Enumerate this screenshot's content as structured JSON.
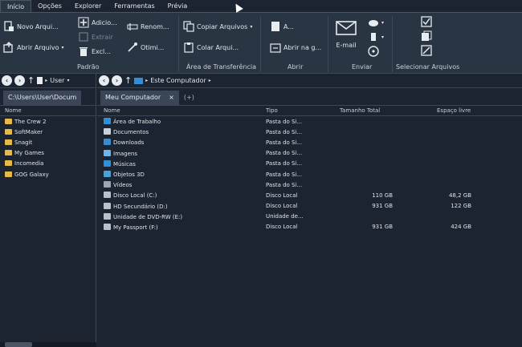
{
  "tabs": [
    "Início",
    "Opções",
    "Explorer",
    "Ferramentas",
    "Prévia"
  ],
  "ribbon": {
    "padrao": {
      "novo": "Novo Arqui...",
      "abrir": "Abrir Arquivo",
      "adicionar": "Adicio...",
      "extrair": "Extrair",
      "excluir": "Excl...",
      "renomear": "Renom...",
      "otimizar": "Otimi...",
      "label": "Padrão"
    },
    "transferencia": {
      "copiar": "Copiar Arquivos",
      "colar": "Colar Arqui...",
      "label": "Área de Transferência"
    },
    "abrir": {
      "a": "A...",
      "abrir_com": "Abrir na g...",
      "label": "Abrir"
    },
    "enviar": {
      "email": "E-mail",
      "label": "Enviar"
    },
    "selecionar": {
      "label": "Selecionar Arquivos"
    }
  },
  "left": {
    "addr": "User",
    "tab": "C:\\Users\\User\\Docum",
    "col_nome": "Nome",
    "items": [
      "The Crew 2",
      "SoftMaker",
      "Snagit",
      "My Games",
      "Incomedia",
      "GOG Galaxy"
    ]
  },
  "right": {
    "addr": "Este Computador",
    "tab": "Meu Computador",
    "tab_close": "×",
    "tab_add": "(+)",
    "cols": {
      "nome": "Nome",
      "tipo": "Tipo",
      "tamanho": "Tamanho Total",
      "espaco": "Espaço livre"
    },
    "rows": [
      {
        "nome": "Área de Trabalho",
        "tipo": "Pasta do Si...",
        "tamanho": "",
        "espaco": ""
      },
      {
        "nome": "Documentos",
        "tipo": "Pasta do Si...",
        "tamanho": "",
        "espaco": ""
      },
      {
        "nome": "Downloads",
        "tipo": "Pasta do Si...",
        "tamanho": "",
        "espaco": ""
      },
      {
        "nome": "Imagens",
        "tipo": "Pasta do Si...",
        "tamanho": "",
        "espaco": ""
      },
      {
        "nome": "Músicas",
        "tipo": "Pasta do Si...",
        "tamanho": "",
        "espaco": ""
      },
      {
        "nome": "Objetos 3D",
        "tipo": "Pasta do Si...",
        "tamanho": "",
        "espaco": ""
      },
      {
        "nome": "Vídeos",
        "tipo": "Pasta do Si...",
        "tamanho": "",
        "espaco": ""
      },
      {
        "nome": "Disco Local (C:)",
        "tipo": "Disco Local",
        "tamanho": "110 GB",
        "espaco": "48,2 GB"
      },
      {
        "nome": "HD Secundário (D:)",
        "tipo": "Disco Local",
        "tamanho": "931 GB",
        "espaco": "122 GB"
      },
      {
        "nome": "Unidade de DVD-RW (E:)",
        "tipo": "Unidade de...",
        "tamanho": "",
        "espaco": ""
      },
      {
        "nome": "My Passport (F:)",
        "tipo": "Disco Local",
        "tamanho": "931 GB",
        "espaco": "424 GB"
      }
    ]
  },
  "colors": {
    "folder": "#e5b94a",
    "accent": "#2f8fd8",
    "bg": "#1b2430",
    "ribbon": "#2a3544"
  }
}
